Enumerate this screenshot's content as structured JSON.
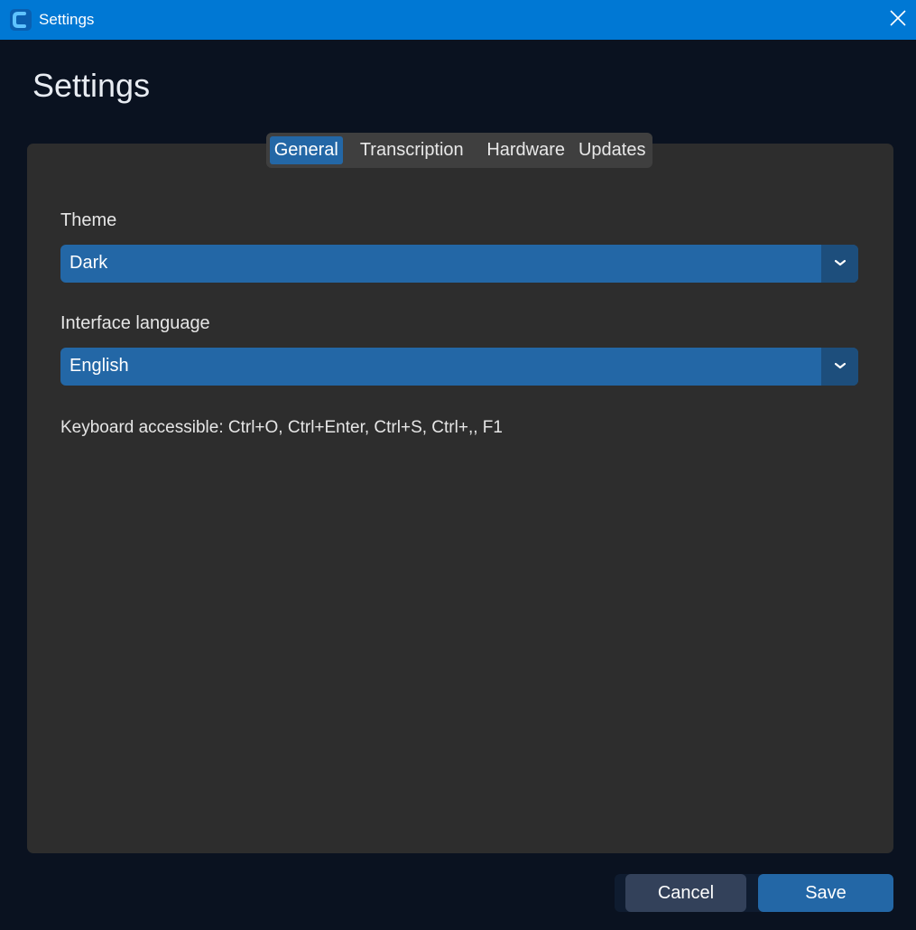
{
  "window": {
    "title": "Settings"
  },
  "page": {
    "title": "Settings"
  },
  "tabs": [
    {
      "label": "General",
      "active": true
    },
    {
      "label": "Transcription",
      "active": false
    },
    {
      "label": "Hardware",
      "active": false
    },
    {
      "label": "Updates",
      "active": false
    }
  ],
  "general": {
    "theme": {
      "label": "Theme",
      "value": "Dark"
    },
    "language": {
      "label": "Interface language",
      "value": "English"
    },
    "shortcuts_hint": "Keyboard accessible: Ctrl+O, Ctrl+Enter, Ctrl+S, Ctrl+,, F1"
  },
  "footer": {
    "cancel_label": "Cancel",
    "save_label": "Save"
  },
  "colors": {
    "titlebar": "#0078d4",
    "background": "#0a1220",
    "panel": "#2d2d2d",
    "accent": "#2367a6"
  },
  "icons": {
    "app": "app-logo-icon",
    "close": "close-icon",
    "dropdown": "chevron-down-icon"
  }
}
